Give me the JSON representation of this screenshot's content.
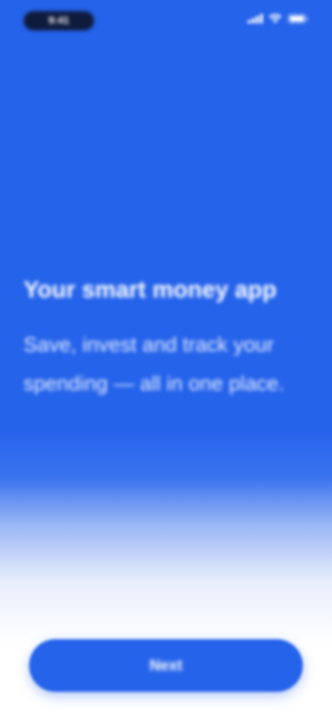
{
  "status_bar": {
    "time": "9:41",
    "icons": [
      "signal-icon",
      "wifi-icon",
      "battery-icon"
    ]
  },
  "onboarding": {
    "title": "Your smart money app",
    "subtitle": "Save, invest and track your spending — all in one place."
  },
  "cta": {
    "label": "Next"
  },
  "colors": {
    "brand": "#2563EB",
    "status_pill": "#0F1B3D",
    "background_bottom": "#FFFFFF"
  }
}
